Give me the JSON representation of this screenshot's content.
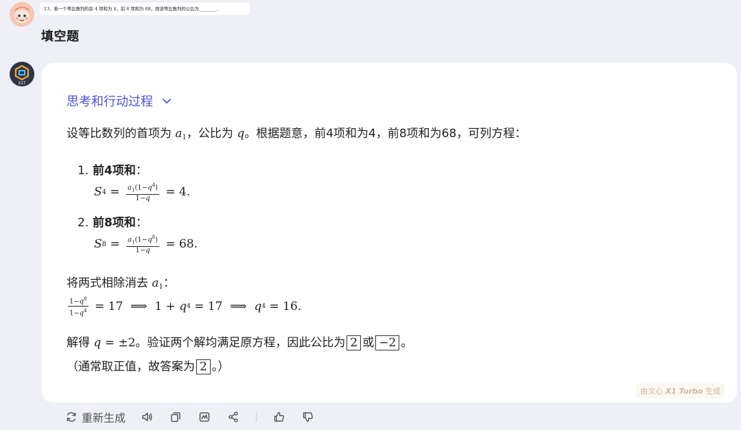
{
  "user": {
    "question_text": "13．若一个等比数列的前 4 项和为 4，前 8 项和为 68，则该等比数列的公比为________．",
    "label": "填空题"
  },
  "bot": {
    "avatar_text": "X1T",
    "thinking_label": "思考和行动过程",
    "intro_a": "设等比数列的首项为",
    "intro_b": "，公比为",
    "intro_c": "。根据题意，前4项和为4，前8项和为68，可列方程：",
    "items": [
      {
        "num": "1.",
        "title": "前4项和",
        "colon": "：",
        "formula_rhs": "= 4."
      },
      {
        "num": "2.",
        "title": "前8项和",
        "colon": "：",
        "formula_rhs": "= 68."
      }
    ],
    "divide_text": "将两式相除消去",
    "divide_colon": "：",
    "chain": {
      "eq1": "= 17",
      "eq2": "1 +",
      "eq3": "= 17",
      "eq4": "= 16."
    },
    "conclusion_a": "解得",
    "conclusion_eq": "= ±2",
    "conclusion_b": "。验证两个解均满足原方程，因此公比为",
    "answer1": "2",
    "conclusion_or": "或",
    "answer2": "−2",
    "conclusion_end": "。",
    "note_a": "（通常取正值，故答案为",
    "note_answer": "2",
    "note_end": "。）",
    "watermark_prefix": "由文心",
    "watermark_model": "X1 Turbo",
    "watermark_suffix": "生成"
  },
  "actions": {
    "regenerate_label": "重新生成"
  },
  "colors": {
    "accent": "#4a54d6",
    "background": "#eef0f6",
    "card": "#ffffff"
  }
}
